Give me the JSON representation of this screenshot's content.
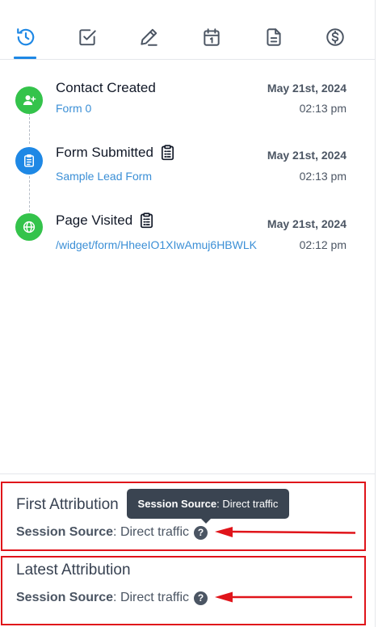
{
  "colors": {
    "accent": "#1e88e5",
    "green": "#34c34b",
    "link": "#3b8fd6",
    "highlight_red": "#e0141a",
    "tooltip_bg": "#3a4451"
  },
  "tabs": [
    {
      "id": "activity",
      "icon": "history-clock-icon",
      "active": true
    },
    {
      "id": "tasks",
      "icon": "checkbox-icon",
      "active": false
    },
    {
      "id": "notes",
      "icon": "pencil-icon",
      "active": false
    },
    {
      "id": "appointments",
      "icon": "calendar-icon",
      "active": false
    },
    {
      "id": "documents",
      "icon": "document-icon",
      "active": false
    },
    {
      "id": "payments",
      "icon": "dollar-circle-icon",
      "active": false
    }
  ],
  "timeline": [
    {
      "title": "Contact Created",
      "subtitle": "Form 0",
      "date": "May 21st, 2024",
      "time": "02:13 pm",
      "icon": "add-user-icon",
      "dot_color": "green",
      "has_clipboard": false
    },
    {
      "title": "Form Submitted",
      "subtitle": "Sample Lead Form",
      "date": "May 21st, 2024",
      "time": "02:13 pm",
      "icon": "clipboard-list-icon",
      "dot_color": "blue",
      "has_clipboard": true
    },
    {
      "title": "Page Visited",
      "subtitle": "/widget/form/HheeIO1XIwAmuj6HBWLK",
      "date": "May 21st, 2024",
      "time": "02:12 pm",
      "icon": "globe-icon",
      "dot_color": "green",
      "has_clipboard": true
    }
  ],
  "first_attribution": {
    "heading": "First Attribution",
    "key": "Session Source",
    "value": ": Direct traffic"
  },
  "latest_attribution": {
    "heading": "Latest Attribution",
    "key": "Session Source",
    "value": ": Direct traffic"
  },
  "tooltip": {
    "key": "Session Source",
    "value": ": Direct traffic"
  },
  "help_glyph": "?"
}
